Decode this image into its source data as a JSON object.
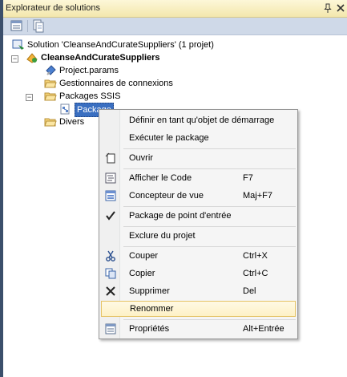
{
  "window": {
    "title": "Explorateur de solutions",
    "pin_icon": "pin-icon",
    "close_icon": "close-icon"
  },
  "toolbar": {
    "buttons": [
      "properties-icon",
      "show-all-files-icon"
    ]
  },
  "tree": {
    "solution": "Solution 'CleanseAndCurateSuppliers' (1 projet)",
    "project": "CleanseAndCurateSuppliers",
    "project_params": "Project.params",
    "connection_managers": "Gestionnaires de connexions",
    "ssis_packages": "Packages SSIS",
    "package": "Package",
    "misc": "Divers"
  },
  "context_menu": {
    "items": [
      {
        "label": "Définir en tant qu'objet de démarrage",
        "shortcut": "",
        "icon": ""
      },
      {
        "label": "Exécuter le package",
        "shortcut": "",
        "icon": ""
      },
      {
        "label": "Ouvrir",
        "shortcut": "",
        "icon": "open-icon"
      },
      {
        "label": "Afficher le Code",
        "shortcut": "F7",
        "icon": "view-code-icon"
      },
      {
        "label": "Concepteur de vue",
        "shortcut": "Maj+F7",
        "icon": "view-designer-icon"
      },
      {
        "label": "Package de point d'entrée",
        "shortcut": "",
        "icon": "check-icon"
      },
      {
        "label": "Exclure du projet",
        "shortcut": "",
        "icon": ""
      },
      {
        "label": "Couper",
        "shortcut": "Ctrl+X",
        "icon": "cut-icon"
      },
      {
        "label": "Copier",
        "shortcut": "Ctrl+C",
        "icon": "copy-icon"
      },
      {
        "label": "Supprimer",
        "shortcut": "Del",
        "icon": "delete-icon"
      },
      {
        "label": "Renommer",
        "shortcut": "",
        "icon": ""
      },
      {
        "label": "Propriétés",
        "shortcut": "Alt+Entrée",
        "icon": "properties-icon"
      }
    ],
    "highlighted": "Renommer"
  }
}
